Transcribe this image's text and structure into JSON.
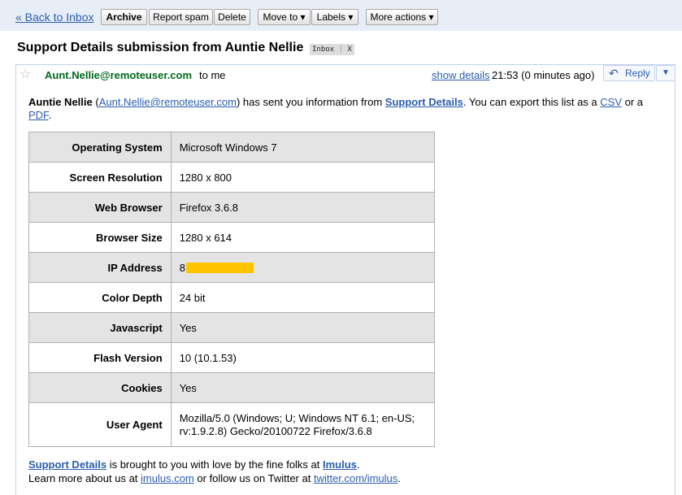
{
  "toolbar": {
    "back_label": "« Back to Inbox",
    "archive_label": "Archive",
    "report_spam_label": "Report spam",
    "delete_label": "Delete",
    "move_to_label": "Move to ▾",
    "labels_label": "Labels ▾",
    "more_actions_label": "More actions ▾"
  },
  "subject": {
    "title": "Support Details submission from Auntie Nellie",
    "label": "Inbox",
    "label_close": "X"
  },
  "message": {
    "sender": "Aunt.Nellie@remoteuser.com",
    "recipient": "to me",
    "show_details": "show details",
    "time": "21:53 (0 minutes ago)",
    "reply_label": "Reply"
  },
  "intro": {
    "name": "Auntie Nellie",
    "paren_open": " (",
    "email": "Aunt.Nellie@remoteuser.com",
    "text1": ") has sent you information from ",
    "source": "Support Details",
    "text2": ". You can export this list as a ",
    "csv": "CSV",
    "text3": " or a ",
    "pdf": "PDF",
    "text4": "."
  },
  "details": [
    {
      "key": "Operating System",
      "value": "Microsoft Windows 7"
    },
    {
      "key": "Screen Resolution",
      "value": "1280 x 800"
    },
    {
      "key": "Web Browser",
      "value": "Firefox 3.6.8"
    },
    {
      "key": "Browser Size",
      "value": "1280 x 614"
    },
    {
      "key": "IP Address",
      "value": "8"
    },
    {
      "key": "Color Depth",
      "value": "24 bit"
    },
    {
      "key": "Javascript",
      "value": "Yes"
    },
    {
      "key": "Flash Version",
      "value": "10 (10.1.53)"
    },
    {
      "key": "Cookies",
      "value": "Yes"
    },
    {
      "key": "User Agent",
      "value": "Mozilla/5.0 (Windows; U; Windows NT 6.1; en-US; rv:1.9.2.8) Gecko/20100722 Firefox/3.6.8"
    }
  ],
  "footer": {
    "link1": "Support Details",
    "text1": " is brought to you with love by the fine folks at ",
    "link2": "Imulus",
    "text2": ".",
    "text3": "Learn more about us at ",
    "link3": "imulus.com",
    "text4": " or follow us on Twitter at ",
    "link4": "twitter.com/imulus",
    "text5": "."
  },
  "colors": {
    "toolbar_bg": "#e8eef7",
    "link": "#2a5db0",
    "sender": "#00681c",
    "row_shade": "#e4e4e4",
    "redaction": "#ffc400"
  }
}
